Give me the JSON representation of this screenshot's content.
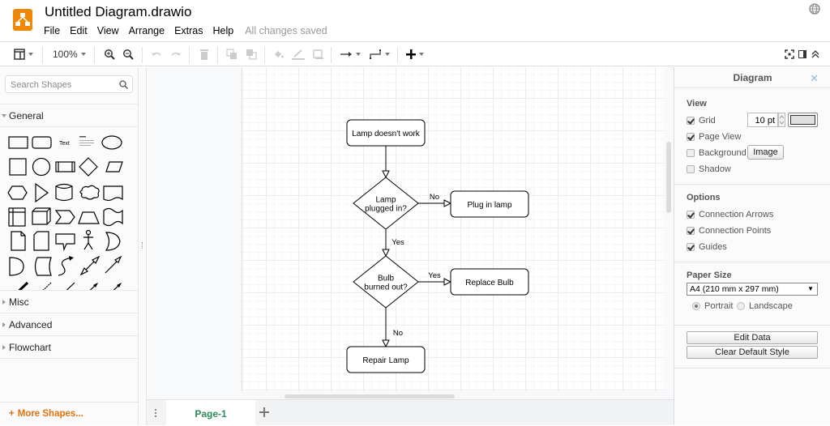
{
  "app": {
    "title": "Untitled Diagram.drawio",
    "menu": [
      "File",
      "Edit",
      "View",
      "Arrange",
      "Extras",
      "Help"
    ],
    "save_status": "All changes saved",
    "brand_color": "#f08705"
  },
  "toolbar": {
    "zoom": "100%",
    "icons": [
      "format-panel-icon",
      "zoom-in-icon",
      "zoom-out-icon",
      "undo-icon",
      "redo-icon",
      "delete-icon",
      "to-front-icon",
      "to-back-icon",
      "fill-color-icon",
      "line-color-icon",
      "shadow-icon",
      "connection-icon",
      "waypoints-icon",
      "insert-icon",
      "fullscreen-icon",
      "toggle-panel-icon",
      "collapse-icon"
    ]
  },
  "sidebar": {
    "search_placeholder": "Search Shapes",
    "sections": [
      {
        "label": "General",
        "expanded": true
      },
      {
        "label": "Misc",
        "expanded": false
      },
      {
        "label": "Advanced",
        "expanded": false
      },
      {
        "label": "Flowchart",
        "expanded": false
      }
    ],
    "text_shape_label": "Text",
    "more_shapes": "More Shapes..."
  },
  "diagram": {
    "nodes": [
      {
        "id": "start",
        "type": "rounded",
        "label": "Lamp doesn't work"
      },
      {
        "id": "d1",
        "type": "diamond",
        "label": [
          "Lamp",
          "plugged in?"
        ]
      },
      {
        "id": "plug",
        "type": "rounded",
        "label": "Plug in lamp"
      },
      {
        "id": "d2",
        "type": "diamond",
        "label": [
          "Bulb",
          "burned out?"
        ]
      },
      {
        "id": "replace",
        "type": "rounded",
        "label": "Replace Bulb"
      },
      {
        "id": "repair",
        "type": "rounded",
        "label": "Repair Lamp"
      }
    ],
    "edges": [
      {
        "from": "start",
        "to": "d1",
        "label": ""
      },
      {
        "from": "d1",
        "to": "plug",
        "label": "No"
      },
      {
        "from": "d1",
        "to": "d2",
        "label": "Yes"
      },
      {
        "from": "d2",
        "to": "replace",
        "label": "Yes"
      },
      {
        "from": "d2",
        "to": "repair",
        "label": "No"
      }
    ]
  },
  "pages": {
    "tabs": [
      "Page-1"
    ],
    "active": "Page-1",
    "active_color": "#2d8a5b"
  },
  "format_panel": {
    "title": "Diagram",
    "view": {
      "heading": "View",
      "grid": {
        "label": "Grid",
        "checked": true,
        "size": "10 pt"
      },
      "page_view": {
        "label": "Page View",
        "checked": true
      },
      "background": {
        "label": "Background",
        "checked": false,
        "button": "Image"
      },
      "shadow": {
        "label": "Shadow",
        "checked": false
      }
    },
    "options": {
      "heading": "Options",
      "connection_arrows": {
        "label": "Connection Arrows",
        "checked": true
      },
      "connection_points": {
        "label": "Connection Points",
        "checked": true
      },
      "guides": {
        "label": "Guides",
        "checked": true
      }
    },
    "paper": {
      "heading": "Paper Size",
      "selected": "A4 (210 mm x 297 mm)",
      "portrait": "Portrait",
      "landscape": "Landscape",
      "orientation": "portrait"
    },
    "buttons": {
      "edit_data": "Edit Data",
      "clear_style": "Clear Default Style"
    }
  }
}
